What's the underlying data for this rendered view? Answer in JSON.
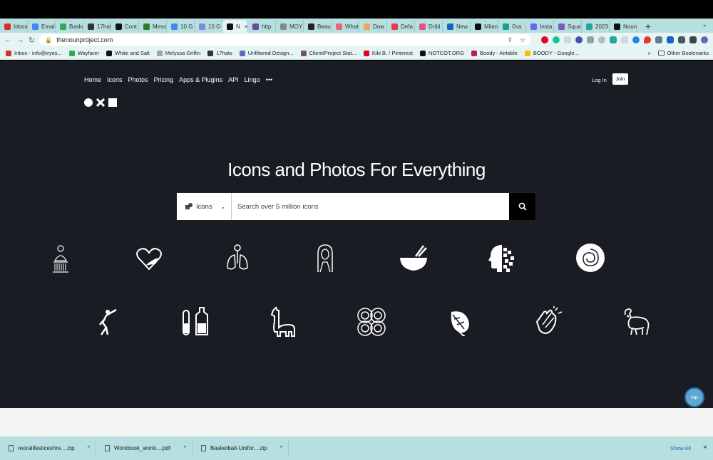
{
  "browser": {
    "tabs": [
      {
        "label": "Inbox",
        "color": "#d93025"
      },
      {
        "label": "Email",
        "color": "#4285f4"
      },
      {
        "label": "Baske",
        "color": "#34a853"
      },
      {
        "label": "17hat",
        "color": "#333333"
      },
      {
        "label": "Cont",
        "color": "#111111"
      },
      {
        "label": "Mess",
        "color": "#2e7d32"
      },
      {
        "label": "10 G",
        "color": "#4285f4"
      },
      {
        "label": "10 G",
        "color": "#7b8cde"
      },
      {
        "label": "N",
        "color": "#111111",
        "active": true
      },
      {
        "label": "http",
        "color": "#6a4c93"
      },
      {
        "label": "MOY",
        "color": "#888888"
      },
      {
        "label": "Beau",
        "color": "#222222"
      },
      {
        "label": "What",
        "color": "#e06c75"
      },
      {
        "label": "Dow",
        "color": "#f4a261"
      },
      {
        "label": "Defa",
        "color": "#e63946"
      },
      {
        "label": "Dribl",
        "color": "#ea4c89"
      },
      {
        "label": "New",
        "color": "#1565c0"
      },
      {
        "label": "Milan",
        "color": "#111111"
      },
      {
        "label": "Gra",
        "color": "#16a085"
      },
      {
        "label": "Insta",
        "color": "#6c63ff"
      },
      {
        "label": "Squa",
        "color": "#7e57c2"
      },
      {
        "label": "2023",
        "color": "#26a69a"
      },
      {
        "label": "Noun",
        "color": "#111111"
      }
    ],
    "new_tab_symbol": "+",
    "tab_menu_symbol": "⌄",
    "url": "thenounproject.com",
    "bookmarks": [
      {
        "label": "Inbox - info@eyes...",
        "color": "#d93025"
      },
      {
        "label": "Wayfarer",
        "color": "#34a853"
      },
      {
        "label": "White and Salt",
        "color": "#111111"
      },
      {
        "label": "Melyssa Griffin",
        "color": "#9aa5b1"
      },
      {
        "label": "17hats",
        "color": "#333333"
      },
      {
        "label": "Unfiltered Design...",
        "color": "#5c6bc0"
      },
      {
        "label": "Client/Project Stat...",
        "color": "#795548"
      },
      {
        "label": "Kiki B. / Pinterest",
        "color": "#e60023"
      },
      {
        "label": "NOTCOT.ORG",
        "color": "#111111"
      },
      {
        "label": "Boody - Airtable",
        "color": "#c2185b"
      },
      {
        "label": "BOODY - Google...",
        "color": "#fbbc04"
      }
    ],
    "bookmarks_more": "»",
    "other_bookmarks": "Other Bookmarks"
  },
  "site": {
    "nav": [
      "Home",
      "Icons",
      "Photos",
      "Pricing",
      "Apps & Plugins",
      "API",
      "Lingo",
      "•••"
    ],
    "login": "Log In",
    "join": "Join",
    "hero_title": "Icons and Photos For Everything",
    "search_type": "Icons",
    "search_placeholder": "Search over 5 million icons",
    "bg_color": "#1a1c24"
  },
  "gallery_icons_row1": [
    "buddha-statue-icon",
    "heart-hand-icon",
    "lungs-flower-icon",
    "woman-portrait-icon",
    "mortar-pestle-icon",
    "pixel-head-icon",
    "round-carpet-icon"
  ],
  "gallery_icons_row2": [
    "dancer-icon",
    "test-tubes-icon",
    "llama-icon",
    "spiral-knot-icon",
    "monstera-leaf-icon",
    "clapping-hands-icon",
    "goat-icon"
  ],
  "downloads": {
    "items": [
      "reoralifesliceshre....zip",
      "Workbook_worki....pdf",
      "Basketball-Unifor....zip"
    ],
    "show_all": "Show All",
    "close": "×"
  },
  "chat_widget": "tvp"
}
